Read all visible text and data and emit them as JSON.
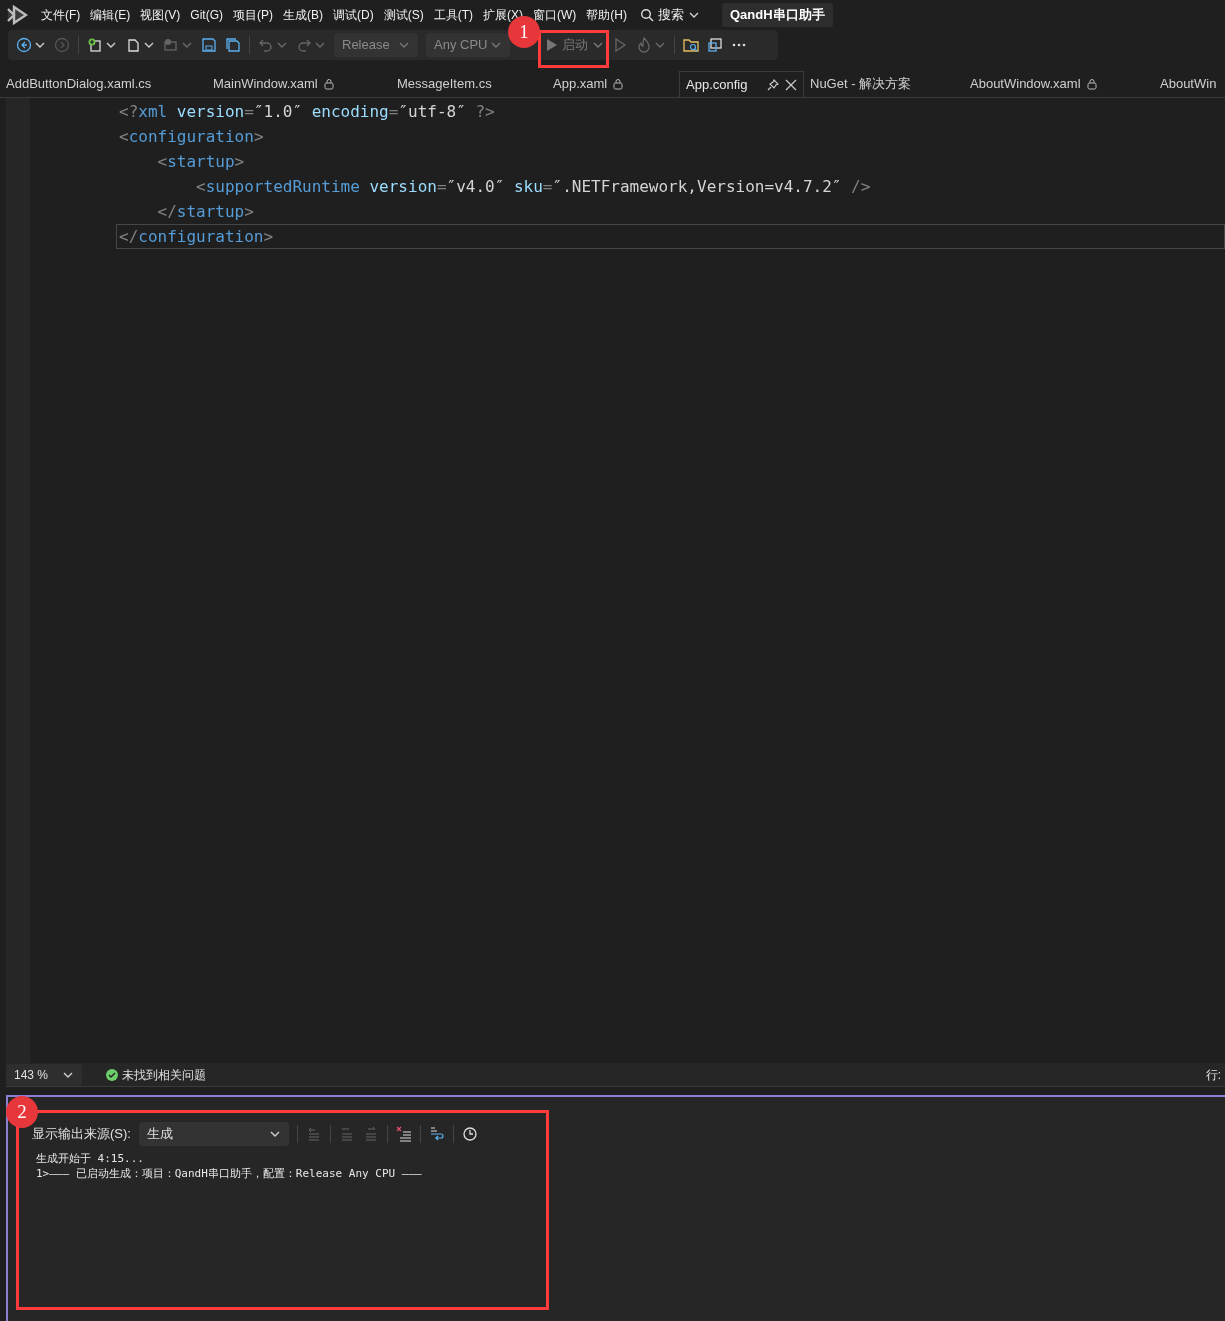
{
  "menu_bar": {
    "items": [
      "文件(F)",
      "编辑(E)",
      "视图(V)",
      "Git(G)",
      "项目(P)",
      "生成(B)",
      "调试(D)",
      "测试(S)",
      "工具(T)",
      "扩展(X)",
      "窗口(W)",
      "帮助(H)"
    ],
    "search": "搜索",
    "solution_name": "QandH串口助手"
  },
  "toolbar": {
    "configuration": "Release",
    "platform": "Any CPU",
    "start_label": "启动"
  },
  "tabs": [
    {
      "label": "AddButtonDialog.xaml.cs",
      "selected": false,
      "locked": false
    },
    {
      "label": "MainWindow.xaml",
      "selected": false,
      "locked": true
    },
    {
      "label": "MessageItem.cs",
      "selected": false,
      "locked": false
    },
    {
      "label": "App.xaml",
      "selected": false,
      "locked": true
    },
    {
      "label": "App.config",
      "selected": true,
      "locked": false
    },
    {
      "label": "NuGet - 解决方案",
      "selected": false,
      "locked": false
    },
    {
      "label": "AboutWindow.xaml",
      "selected": false,
      "locked": true
    },
    {
      "label": "AboutWin",
      "selected": false,
      "locked": false
    }
  ],
  "editor": {
    "lines": [
      {
        "current": false,
        "tokens": [
          {
            "kind": "bracket",
            "text": "<?"
          },
          {
            "kind": "tag",
            "text": "xml"
          },
          {
            "kind": "attr",
            "text": " version"
          },
          {
            "kind": "bracket",
            "text": "="
          },
          {
            "kind": "value",
            "text": "″1.0″"
          },
          {
            "kind": "attr",
            "text": " encoding"
          },
          {
            "kind": "bracket",
            "text": "="
          },
          {
            "kind": "value",
            "text": "″utf-8″"
          },
          {
            "kind": "bracket",
            "text": " ?>"
          }
        ]
      },
      {
        "current": false,
        "tokens": [
          {
            "kind": "bracket",
            "text": "<"
          },
          {
            "kind": "tag",
            "text": "configuration"
          },
          {
            "kind": "bracket",
            "text": ">"
          }
        ]
      },
      {
        "current": false,
        "tokens": [
          {
            "kind": "bracket",
            "text": "    <"
          },
          {
            "kind": "tag",
            "text": "startup"
          },
          {
            "kind": "bracket",
            "text": ">"
          }
        ]
      },
      {
        "current": false,
        "tokens": [
          {
            "kind": "bracket",
            "text": "        <"
          },
          {
            "kind": "tag",
            "text": "supportedRuntime"
          },
          {
            "kind": "attr",
            "text": " version"
          },
          {
            "kind": "bracket",
            "text": "="
          },
          {
            "kind": "value",
            "text": "″v4.0″"
          },
          {
            "kind": "attr",
            "text": " sku"
          },
          {
            "kind": "bracket",
            "text": "="
          },
          {
            "kind": "value",
            "text": "″.NETFramework,Version=v4.7.2″"
          },
          {
            "kind": "bracket",
            "text": " />"
          }
        ]
      },
      {
        "current": false,
        "tokens": [
          {
            "kind": "bracket",
            "text": "    </"
          },
          {
            "kind": "tag",
            "text": "startup"
          },
          {
            "kind": "bracket",
            "text": ">"
          }
        ]
      },
      {
        "current": true,
        "tokens": [
          {
            "kind": "bracket",
            "text": "</"
          },
          {
            "kind": "tag",
            "text": "configuration"
          },
          {
            "kind": "bracket",
            "text": ">"
          }
        ]
      }
    ]
  },
  "status_bar": {
    "zoom": "143 %",
    "issues": "未找到相关问题",
    "line_label": "行:"
  },
  "output": {
    "source_label": "显示输出来源(S):",
    "source": "生成",
    "lines": [
      "生成开始于 4:15...",
      "1>——— 已启动生成：项目：QandH串口助手，配置：Release Any CPU ———"
    ]
  },
  "annotations": [
    {
      "label": "1"
    },
    {
      "label": "2"
    }
  ]
}
